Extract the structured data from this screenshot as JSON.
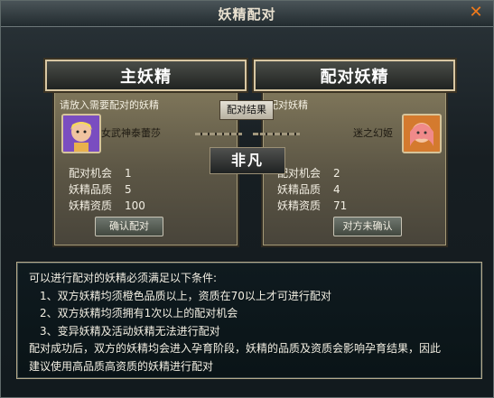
{
  "window": {
    "title": "妖精配对",
    "close_icon": "close-icon"
  },
  "left_panel": {
    "header": "主妖精",
    "subtitle": "请放入需要配对的妖精",
    "pet_name": "女武神泰蕾莎",
    "stats": [
      {
        "label": "配对机会",
        "value": "1"
      },
      {
        "label": "妖精品质",
        "value": "5"
      },
      {
        "label": "妖精资质",
        "value": "100"
      }
    ],
    "button": "确认配对"
  },
  "right_panel": {
    "header": "配对妖精",
    "subtitle": "配对妖精",
    "pet_name": "迷之幻姬",
    "stats": [
      {
        "label": "配对机会",
        "value": "2"
      },
      {
        "label": "妖精品质",
        "value": "4"
      },
      {
        "label": "妖精资质",
        "value": "71"
      }
    ],
    "button": "对方未确认"
  },
  "middle": {
    "label": "配对结果",
    "result": "非凡"
  },
  "conditions": {
    "title": "可以进行配对的妖精必须满足以下条件:",
    "items": [
      "1、双方妖精均须橙色品质以上，资质在70以上才可进行配对",
      "2、双方妖精均须拥有1次以上的配对机会",
      "3、变异妖精及活动妖精无法进行配对"
    ],
    "footer1": "配对成功后，双方的妖精均会进入孕育阶段，妖精的品质及资质会影响孕育结果，因此",
    "footer2": "建议使用高品质高资质的妖精进行配对"
  },
  "colors": {
    "accent": "#f07a1b",
    "panel": "#6f674f"
  }
}
